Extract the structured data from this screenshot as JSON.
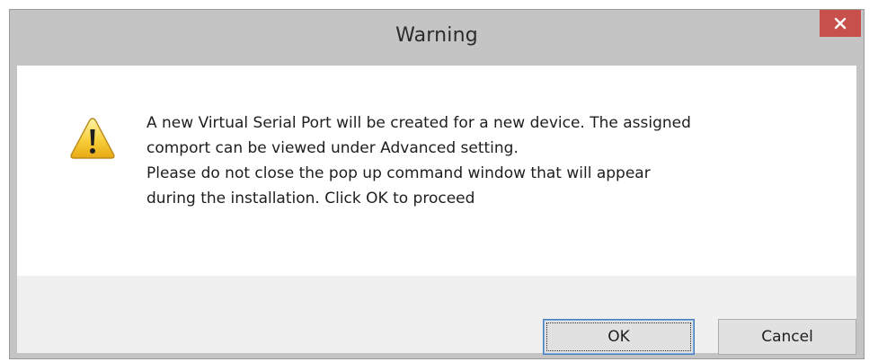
{
  "dialog": {
    "title": "Warning",
    "close_icon": "close-icon",
    "warning_icon": "warning-icon",
    "message_lines": [
      "A new Virtual Serial Port will be created for a new device. The assigned",
      "comport can be viewed under Advanced setting.",
      "Please do not close the pop up command window that will appear",
      "during the installation. Click OK to proceed"
    ],
    "ok_label": "OK",
    "cancel_label": "Cancel"
  },
  "colors": {
    "titlebar": "#c4c4c4",
    "close_button": "#c7504b",
    "footer": "#f0f0f0",
    "button_face": "#e1e1e1",
    "default_button_border": "#4a7fbf"
  }
}
